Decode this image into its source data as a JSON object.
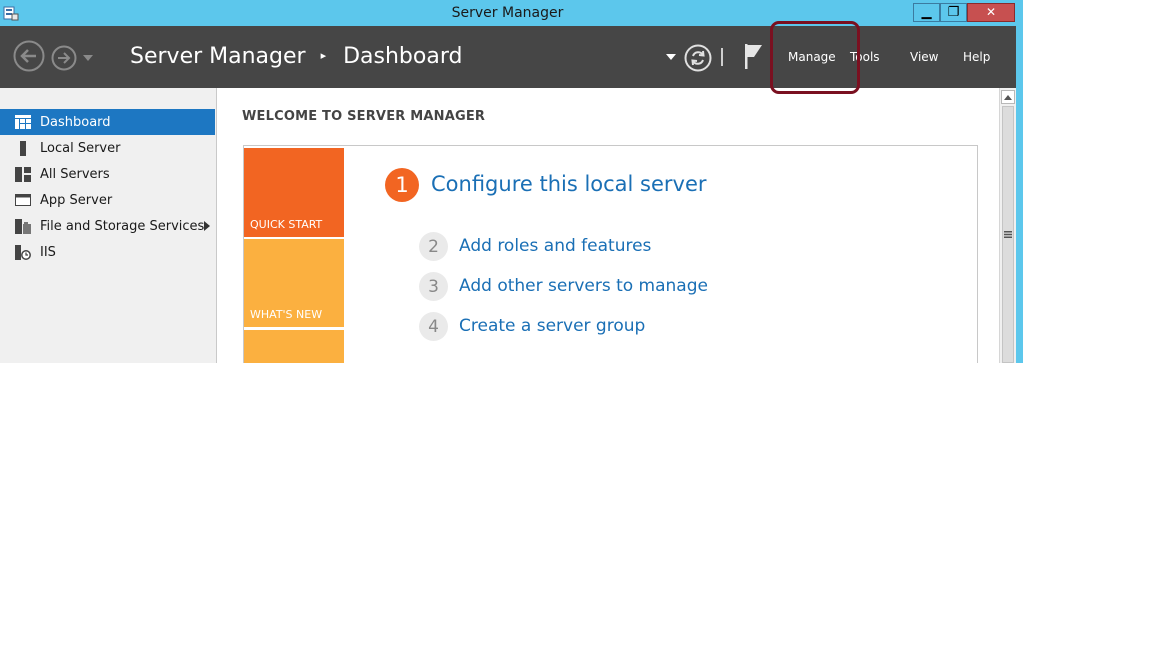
{
  "window": {
    "title": "Server Manager",
    "controls": {
      "minimize": "▁",
      "maximize": "❐",
      "close": "✕"
    }
  },
  "header": {
    "breadcrumb": [
      "Server Manager",
      "Dashboard"
    ],
    "breadcrumb_separator": "▸",
    "menu": [
      "Manage",
      "Tools",
      "View",
      "Help"
    ],
    "icons": [
      "back-arrow-icon",
      "forward-arrow-icon",
      "dropdown-icon",
      "refresh-icon",
      "flag-icon"
    ]
  },
  "sidebar": {
    "items": [
      {
        "label": "Dashboard",
        "icon": "dashboard-grid-icon",
        "active": true
      },
      {
        "label": "Local Server",
        "icon": "server-tower-icon"
      },
      {
        "label": "All Servers",
        "icon": "all-servers-icon"
      },
      {
        "label": "App Server",
        "icon": "app-server-icon"
      },
      {
        "label": "File and Storage Services",
        "icon": "file-storage-icon",
        "has_submenu": true
      },
      {
        "label": "IIS",
        "icon": "iis-icon"
      }
    ]
  },
  "main": {
    "welcome_heading": "WELCOME TO SERVER MANAGER",
    "tiles": [
      "QUICK START",
      "WHAT'S NEW"
    ],
    "steps": [
      {
        "number": "1",
        "label": "Configure this local server"
      },
      {
        "number": "2",
        "label": "Add roles and features"
      },
      {
        "number": "3",
        "label": "Add other servers to manage"
      },
      {
        "number": "4",
        "label": "Create a server group"
      }
    ]
  },
  "colors": {
    "titlebar": "#5cc7ec",
    "header": "#464646",
    "sidebar_active": "#1d77c2",
    "quick_start": "#f26522",
    "whats_new": "#fbb040",
    "link": "#1a6fb5",
    "highlight": "#7a1020"
  }
}
